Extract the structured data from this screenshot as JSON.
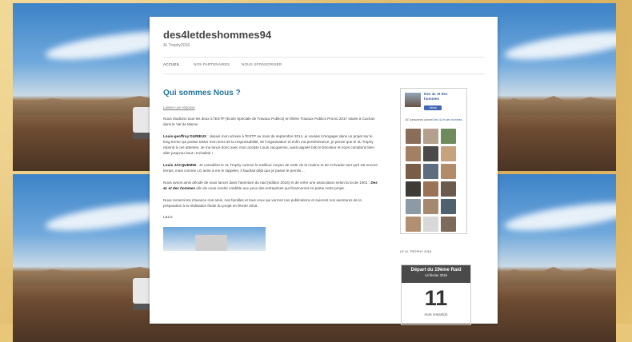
{
  "site": {
    "title": "des4letdeshommes94",
    "tagline": "4L Trophy2016"
  },
  "nav": [
    "ACCUEIL",
    "NOS PARTENAIRES",
    "NOUS SPONSORISER"
  ],
  "post": {
    "title": "Qui sommes Nous ?",
    "reply_link": "Laisser une réponse",
    "p1": "Nous étudions tous les deux à l'ESTP (Ecole Spéciale de Travaux Publics) en filière Travaux Publics Promo 2017 située à Cachan dans le Val de Marne.",
    "p2_name": "Louis-geoffroy DURIEUX",
    "p2_text": ": depuis mon arrivée à l'ESTP au mois de septembre 2014, je voulais m'engager dans un projet sur le long terme qui puisse tester mon sens de la responsabilité, de l'organisation et enfin ma persévérance, je pense que le 4L Trophy répond à ces attentes. Je me lance donc avec mon acolyte Louis Jacquemin, aussi appelé bob le bricoleur et nous comptons bien aller jusqu'au bout ! Inchallah !",
    "p3_name": "Louis JACQUEMIN",
    "p3_text": ": Je considère le 4L Trophy comme le meilleur moyen de sortir de la routine et de m'évader tant qu'il est encore temps, mais comme LG aime à me le rappeler, il faudrait déjà que je passe le permis…",
    "p4_a": "Nous avons ainsi décidé de nous lancer dans l'aventure du raid (édition 2016) et de créer une association selon la loi de 1901 :",
    "p4_b": "Des 4L et des hommes",
    "p4_c": "afin de nous rendre crédible aux yeux des entreprises qui financeront en partie notre projet.",
    "p5": "Nous remercions d'avance nos amis, nos familles et tous ceux qui verront nos publications et suivront nos aventures de la préparation à la réalisation finale du projet en février 2016.",
    "signature": "L&LG"
  },
  "facebook": {
    "page_name": "Des 4L et des hommes",
    "like_label": "J'aime",
    "count_text": "167 personnes aiment",
    "count_link": "Des 4L et des hommes."
  },
  "widget": {
    "label": "LE 4L TROPHY 2016",
    "countdown_title": "Départ du 19ème Raid",
    "countdown_date": "14 février 2016",
    "countdown_value": "11",
    "countdown_unit": "mois restant(s)"
  },
  "colors": {
    "link": "#21759b",
    "facebook": "#3b5998",
    "countdown_header": "#4a4a4a"
  }
}
